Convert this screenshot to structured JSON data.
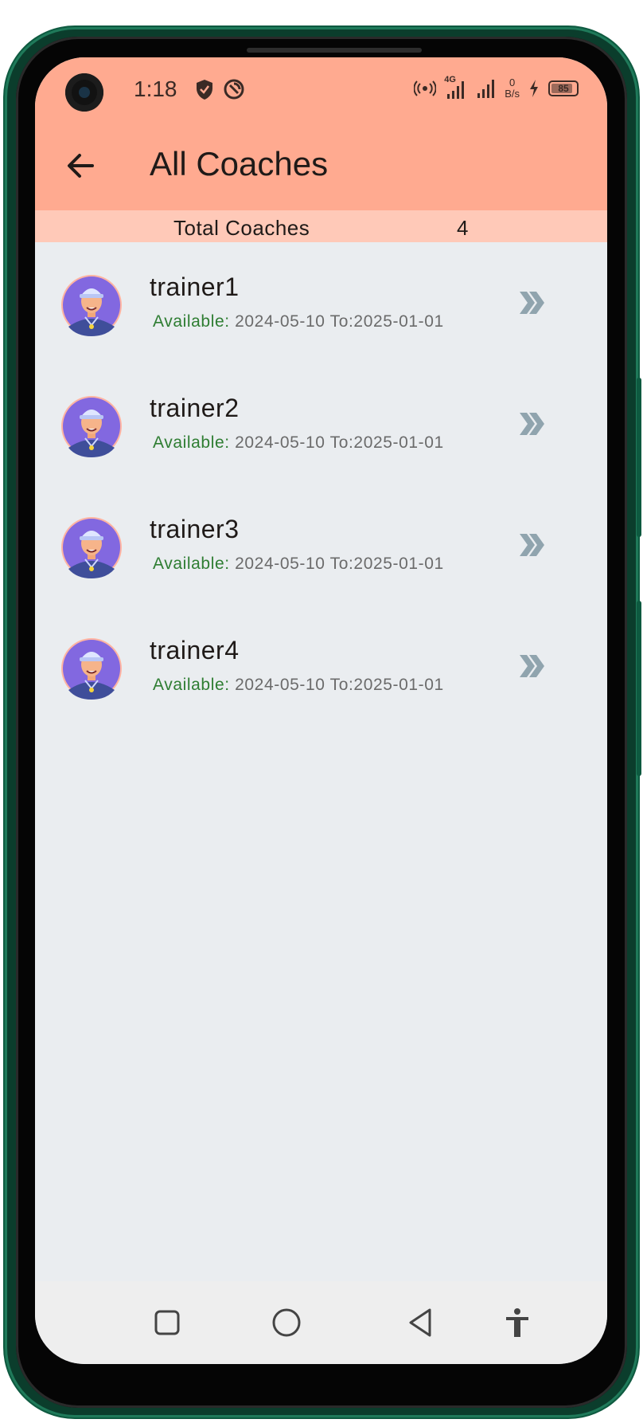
{
  "status_bar": {
    "time": "1:18",
    "network_type": "4G",
    "speed_value": "0",
    "speed_unit": "B/s",
    "battery": "85"
  },
  "header": {
    "title": "All Coaches"
  },
  "summary": {
    "label": "Total Coaches",
    "value": "4"
  },
  "coaches": [
    {
      "name": "trainer1",
      "available_label": "Available:",
      "range": " 2024-05-10 To:2025-01-01"
    },
    {
      "name": "trainer2",
      "available_label": "Available:",
      "range": " 2024-05-10 To:2025-01-01"
    },
    {
      "name": "trainer3",
      "available_label": "Available:",
      "range": " 2024-05-10 To:2025-01-01"
    },
    {
      "name": "trainer4",
      "available_label": "Available:",
      "range": " 2024-05-10 To:2025-01-01"
    }
  ],
  "icons": {
    "back": "arrow-back-icon",
    "chevron": "double-chevron-right-icon",
    "avatar": "coach-avatar-icon",
    "nav_recents": "square-icon",
    "nav_home": "circle-icon",
    "nav_back": "triangle-back-icon",
    "accessibility": "accessibility-icon"
  },
  "colors": {
    "appbar": "#ffaa90",
    "summary_bar": "#ffc9b8",
    "available_label": "#2e7d32",
    "chevron": "#90a4ae",
    "background": "#eaedf0"
  }
}
